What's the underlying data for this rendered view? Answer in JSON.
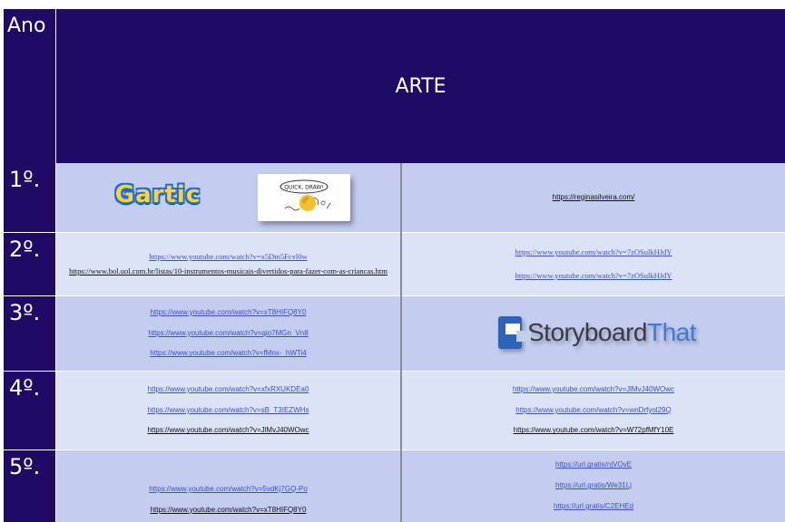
{
  "header": {
    "ano": "Ano",
    "arte": "ARTE"
  },
  "rows": [
    {
      "num": "1º."
    },
    {
      "num": "2º."
    },
    {
      "num": "3º."
    },
    {
      "num": "4º."
    },
    {
      "num": "5º."
    }
  ],
  "row1": {
    "gartic_logo": "Gartic",
    "quickdraw_logo": "QUICK, DRAW!",
    "right_link": "https://reginasilveira.com/"
  },
  "row2": {
    "left_links": [
      "https://www.youtube.com/watch?v=x5Dm5Fcvl0w",
      "https://www.bol.uol.com.br/listas/10-instrumentos-musicais-divertidos-para-fazer-com-as-criancas.htm"
    ],
    "right_links": [
      "https://www.youtube.com/watch?v=7zOSulkHJdY",
      "https://www.youtube.com/watch?v=7zOSulkHJdY"
    ]
  },
  "row3": {
    "left_links": [
      "https://www.youtube.com/watch?v=xT8HIFQ8Y0",
      "https://www.youtube.com/watch?v=qio7MGn_Vn8",
      "https://www.youtube.com/watch?v=fMnx-_hWTi4"
    ],
    "storyboard_a": "Storyboard",
    "storyboard_b": "That"
  },
  "row4": {
    "left_links": [
      "https://www.youtube.com/watch?v=xfxRXUKDEa0",
      "https://www.youtube.com/watch?v=sB_T3IEZWHs",
      "https://www.youtube.com/watch?v=JlMvJ40WOwc"
    ],
    "right_links": [
      "https://www.youtube.com/watch?v=JlMvJ40WOwc",
      "https://www.youtube.com/watch?v=wnDrfyol29Q",
      "https://www.youtube.com/watch?v=W72pfMfY10E"
    ]
  },
  "row5": {
    "left_links": [
      "https://www.youtube.com/watch?v=5vdKj7GQ-Po",
      "https://www.youtube.com/watch?v=xT8HIFQ8Y0"
    ],
    "right_links": [
      "https://url.gratis/njVOvE",
      "https://url.gratis/We31Lj",
      "https://url.gratis/C2EHEd"
    ]
  },
  "colors": {
    "header": "#1f0a66",
    "row_light": "#dde3f7",
    "row_dark": "#c4cdef",
    "link": "#3a4ec9"
  }
}
